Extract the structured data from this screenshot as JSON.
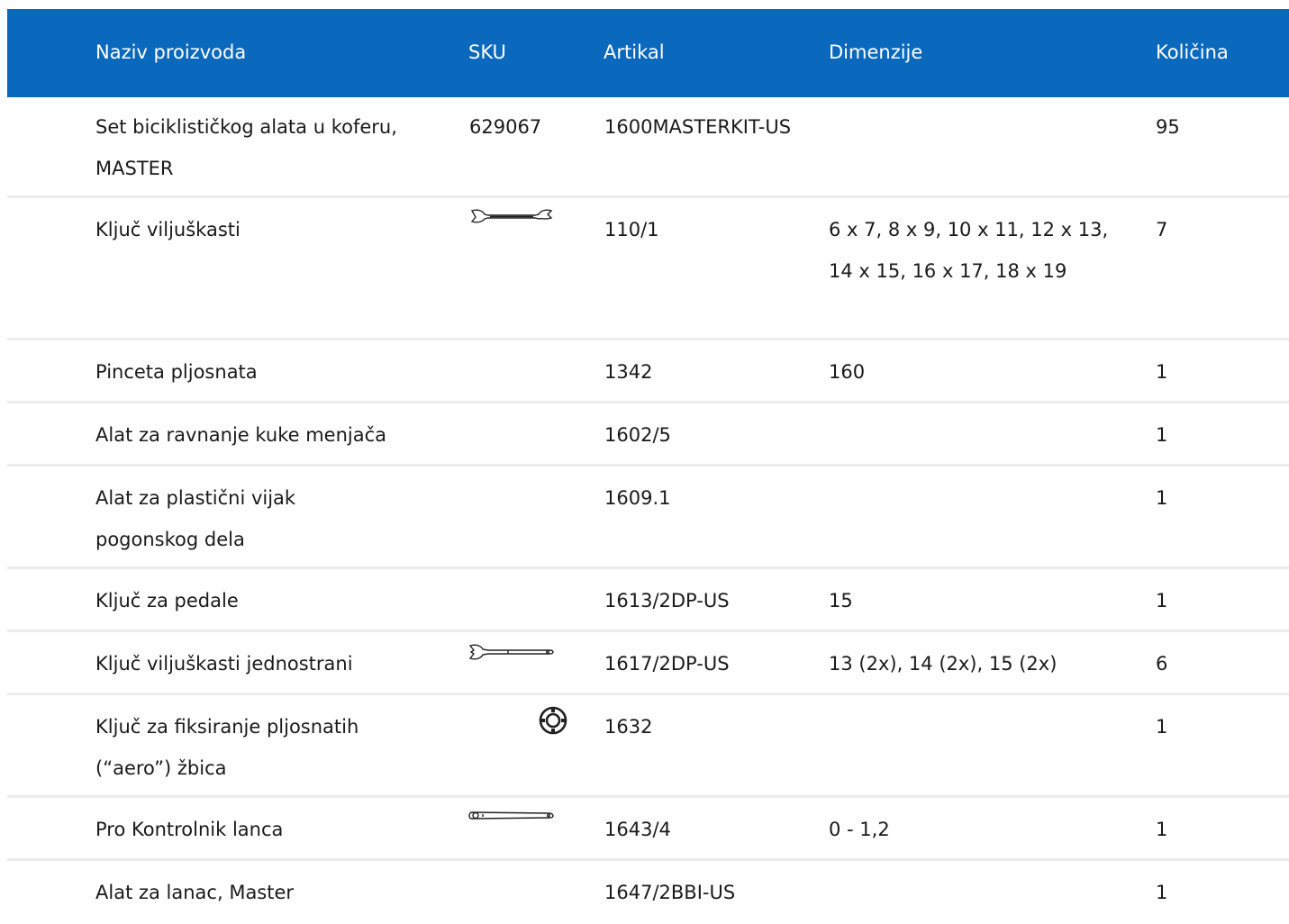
{
  "table": {
    "headers": [
      "Naziv proizvoda",
      "SKU",
      "Artikal",
      "Dimenzije",
      "Količina"
    ],
    "rows": [
      {
        "name": "Set biciklističkog alata u koferu, MASTER",
        "sku": "629067",
        "article": "1600MASTERKIT-US",
        "dimensions": "",
        "qty": "95",
        "icon": ""
      },
      {
        "name": "Ključ viljuškasti",
        "sku": "",
        "article": "110/1",
        "dimensions": "6 x 7, 8 x 9, 10 x 11, 12 x 13, 14 x 15, 16 x 17, 18 x 19",
        "qty": "7",
        "icon": "double-open-end-wrench-icon"
      },
      {
        "name": "Pinceta pljosnata",
        "sku": "",
        "article": "1342",
        "dimensions": "160",
        "qty": "1",
        "icon": ""
      },
      {
        "name": "Alat za ravnanje kuke menjača",
        "sku": "",
        "article": "1602/5",
        "dimensions": "",
        "qty": "1",
        "icon": ""
      },
      {
        "name": "Alat za plastični vijak pogonskog dela",
        "sku": "",
        "article": "1609.1",
        "dimensions": "",
        "qty": "1",
        "icon": ""
      },
      {
        "name": "Ključ za pedale",
        "sku": "",
        "article": "1613/2DP-US",
        "dimensions": "15",
        "qty": "1",
        "icon": ""
      },
      {
        "name": "Ključ viljuškasti jednostrani",
        "sku": "",
        "article": "1617/2DP-US",
        "dimensions": "13 (2x), 14 (2x), 15 (2x)",
        "qty": "6",
        "icon": "single-open-end-wrench-icon"
      },
      {
        "name": "Ključ za fiksiranje pljosnatih (“aero”) žbica",
        "sku": "",
        "article": "1632",
        "dimensions": "",
        "qty": "1",
        "icon": "spoke-holder-icon"
      },
      {
        "name": "Pro Kontrolnik lanca",
        "sku": "",
        "article": "1643/4",
        "dimensions": "0 - 1,2",
        "qty": "1",
        "icon": "chain-checker-icon"
      },
      {
        "name": "Alat za lanac, Master",
        "sku": "",
        "article": "1647/2BBI-US",
        "dimensions": "",
        "qty": "1",
        "icon": ""
      }
    ]
  },
  "colors": {
    "header_bg": "#0a68bd",
    "header_text": "#ffffff",
    "row_divider": "#ececec"
  }
}
